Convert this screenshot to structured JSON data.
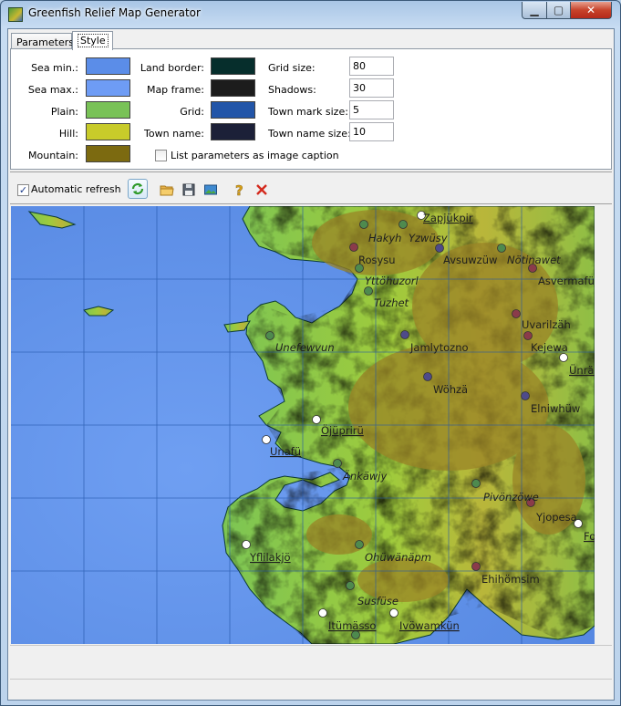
{
  "window": {
    "title": "Greenfish Relief Map Generator",
    "minimize": "▁",
    "maximize": "▢",
    "close": "✕"
  },
  "tabs": [
    {
      "label": "Parameters"
    },
    {
      "label": "Style"
    }
  ],
  "style": {
    "col1": [
      {
        "label": "Sea min.:",
        "color": "#5b8de8"
      },
      {
        "label": "Sea max.:",
        "color": "#6e9cf5"
      },
      {
        "label": "Plain:",
        "color": "#79c257"
      },
      {
        "label": "Hill:",
        "color": "#c8cb2a"
      },
      {
        "label": "Mountain:",
        "color": "#7c6a10"
      }
    ],
    "col2": [
      {
        "label": "Land border:",
        "color": "#062e2c"
      },
      {
        "label": "Map frame:",
        "color": "#1c1c1c"
      },
      {
        "label": "Grid:",
        "color": "#2255a8"
      },
      {
        "label": "Town name:",
        "color": "#1c2038"
      }
    ],
    "col3": [
      {
        "label": "Grid size:",
        "value": "80"
      },
      {
        "label": "Shadows:",
        "value": "30"
      },
      {
        "label": "Town mark size:",
        "value": "5"
      },
      {
        "label": "Town name size:",
        "value": "10"
      }
    ],
    "caption_checkbox": {
      "label": "List parameters as image caption",
      "checked": false
    }
  },
  "toolbar": {
    "auto_refresh_label": "Automatic refresh",
    "auto_refresh_checked": true,
    "icons": [
      "refresh-icon",
      "open-folder-icon",
      "save-icon",
      "export-image-icon",
      "help-icon",
      "close-red-icon"
    ]
  },
  "map": {
    "towns": [
      {
        "name": "Zapjükpir",
        "style": "u"
      },
      {
        "name": "Hakyh",
        "style": "i"
      },
      {
        "name": "Yzwüsy",
        "style": "i"
      },
      {
        "name": "Rosysu",
        "style": ""
      },
      {
        "name": "Avsuwzüw",
        "style": ""
      },
      {
        "name": "Nötinawet",
        "style": "i"
      },
      {
        "name": "Yttöhuzorl",
        "style": "i"
      },
      {
        "name": "Asvermafü",
        "style": ""
      },
      {
        "name": "Tuzhet",
        "style": "i"
      },
      {
        "name": "Uvarilzäh",
        "style": ""
      },
      {
        "name": "Unefewvun",
        "style": "i"
      },
      {
        "name": "Jamlytozno",
        "style": ""
      },
      {
        "name": "Kejewa",
        "style": ""
      },
      {
        "name": "Ünräv",
        "style": "u"
      },
      {
        "name": "Wöhzä",
        "style": ""
      },
      {
        "name": "Elniwhüw",
        "style": ""
      },
      {
        "name": "Öjüprirü",
        "style": "u"
      },
      {
        "name": "Unafü",
        "style": "u"
      },
      {
        "name": "Änkäwjy",
        "style": "i"
      },
      {
        "name": "Pivönzöwe",
        "style": "i"
      },
      {
        "name": "Yjopesa",
        "style": ""
      },
      {
        "name": "Fo",
        "style": "u"
      },
      {
        "name": "Yflilakjö",
        "style": "u"
      },
      {
        "name": "Ohüwänäpm",
        "style": "i"
      },
      {
        "name": "Ehihömsim",
        "style": ""
      },
      {
        "name": "Susfüse",
        "style": "i"
      },
      {
        "name": "Itümässo",
        "style": "u"
      },
      {
        "name": "Ivöwamkün",
        "style": "u"
      }
    ]
  }
}
